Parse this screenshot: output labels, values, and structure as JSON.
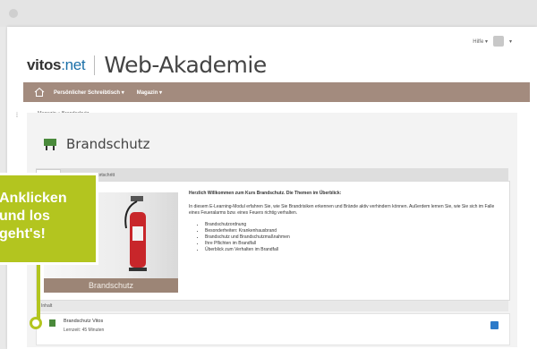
{
  "header": {
    "help_label": "Hilfe ▾",
    "user_caret": "▾"
  },
  "logo": {
    "brand_main": "vitos",
    "brand_suffix": ":net",
    "title": "Web-Akademie"
  },
  "nav": {
    "items": [
      {
        "label": "Persönlicher Schreibtisch ▾"
      },
      {
        "label": "Magazin ▾"
      }
    ]
  },
  "breadcrumb": {
    "items": [
      "Magazin",
      "Brandschutz"
    ],
    "separator": "»"
  },
  "page": {
    "title": "Brandschutz"
  },
  "tabs": [
    {
      "label": "Inhalt",
      "active": true
    },
    {
      "label": "Info",
      "active": false
    },
    {
      "label": "Lernfortschritt",
      "active": false
    }
  ],
  "hero": {
    "caption": "Brandschutz"
  },
  "description": {
    "heading": "Herzlich Willkommen zum Kurs Brandschutz. Die Themen im Überblick:",
    "paragraph": "In diesem E-Learning-Modul erfahren Sie, wie Sie Brandrisiken erkennen und Brände aktiv verhindern können. Außerdem lernen Sie, wie Sie sich im Falle eines Feueralarms bzw. eines Feuers richtig verhalten.",
    "bullets": [
      "Brandschutzordnung",
      "Besonderheiten: Krankenhausbrand",
      "Brandschutz und Brandschutzmaßnahmen",
      "Ihre Pflichten im Brandfall",
      "Überblick zum Verhalten im Brandfall"
    ]
  },
  "section": {
    "label": "Inhalt"
  },
  "list_item": {
    "title": "Brandschutz Vitos",
    "meta": "Lernzeit: 45 Minuten"
  },
  "callout": {
    "text": "Anklicken\nund los\ngeht's!"
  },
  "colors": {
    "nav_bar": "#a38b7e",
    "callout": "#b3c51f",
    "action_button": "#2b7ac9",
    "brand_blue": "#1a6fa8"
  }
}
